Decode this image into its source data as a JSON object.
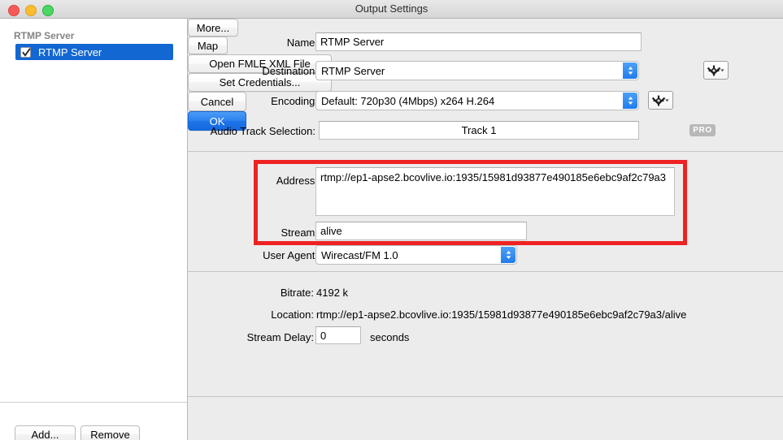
{
  "window": {
    "title": "Output Settings",
    "traffic_lights": [
      "close",
      "minimize",
      "maximize"
    ]
  },
  "sidebar": {
    "header": "RTMP Server",
    "items": [
      {
        "label": "RTMP Server",
        "checked": true,
        "selected": true
      }
    ],
    "add_label": "Add...",
    "remove_label": "Remove"
  },
  "form": {
    "name_label": "Name:",
    "name_value": "RTMP Server",
    "destination_label": "Destination:",
    "destination_value": "RTMP Server",
    "more_label": "More...",
    "encoding_label": "Encoding:",
    "encoding_value": "Default: 720p30 (4Mbps) x264 H.264",
    "audio_track_label": "Audio Track Selection:",
    "audio_track_value": "Track 1",
    "map_label": "Map",
    "pro_badge": "PRO",
    "address_label": "Address:",
    "address_value": "rtmp://ep1-apse2.bcovlive.io:1935/15981d93877e490185e6ebc9af2c79a3",
    "stream_label": "Stream:",
    "stream_value": "alive",
    "open_fmle_label": "Open FMLE XML File",
    "user_agent_label": "User Agent:",
    "user_agent_value": "Wirecast/FM 1.0",
    "set_credentials_label": "Set Credentials..."
  },
  "summary": {
    "bitrate_label": "Bitrate:",
    "bitrate_value": "4192 k",
    "location_label": "Location:",
    "location_value": "rtmp://ep1-apse2.bcovlive.io:1935/15981d93877e490185e6ebc9af2c79a3/alive",
    "stream_delay_label": "Stream Delay:",
    "stream_delay_value": "0",
    "seconds_label": "seconds"
  },
  "footer": {
    "cancel_label": "Cancel",
    "ok_label": "OK"
  },
  "colors": {
    "selection_blue": "#1267d2",
    "accent_blue": "#2a80ef",
    "highlight_red": "#ee2222",
    "window_bg": "#ececec",
    "sidebar_bg": "#ffffff"
  }
}
